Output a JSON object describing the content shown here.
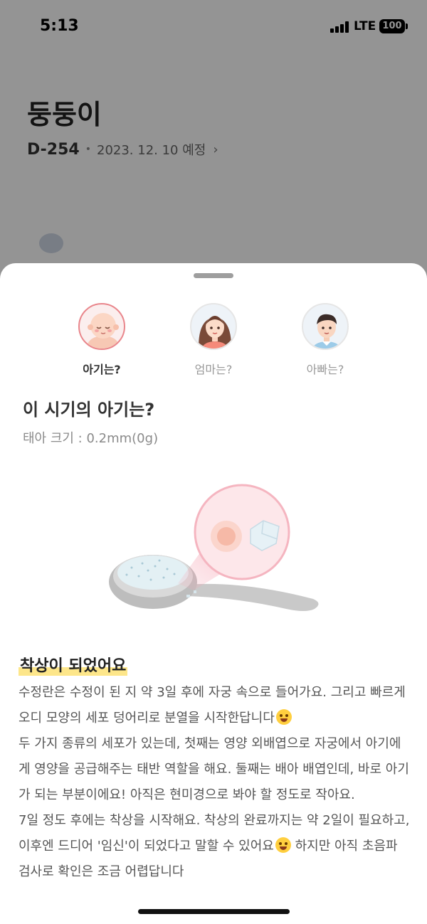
{
  "status_bar": {
    "time": "5:13",
    "network": "LTE",
    "battery": "100"
  },
  "background": {
    "baby_name": "둥둥이",
    "dday": "D-254",
    "separator": "•",
    "due_date": "2023. 12. 10 예정",
    "chevron": "›"
  },
  "sheet": {
    "tabs": [
      {
        "label": "아기는?",
        "icon": "baby-avatar-icon",
        "active": true
      },
      {
        "label": "엄마는?",
        "icon": "mother-avatar-icon",
        "active": false
      },
      {
        "label": "아빠는?",
        "icon": "father-avatar-icon",
        "active": false
      }
    ],
    "title": "이 시기의 아기는?",
    "fetal_size": "태아 크기 : 0.2mm(0g)",
    "illustration": "spoon-with-salt-grains-illustration",
    "headline": "착상이 되었어요",
    "paragraphs": [
      "수정란은 수정이 된 지 약 3일 후에 자궁 속으로 들어가요. 그리고 빠르게 오디 모양의 세포 덩어리로 분열을 시작한답니다",
      "두 가지 종류의 세포가 있는데, 첫째는 영양 외배엽으로 자궁에서 아기에게 영양을 공급해주는 태반 역할을 해요. 둘째는 배아 배엽인데, 바로 아기가 되는 부분이에요! 아직은 현미경으로 봐야 할 정도로 작아요.",
      "7일 정도 후에는 착상을 시작해요. 착상의 완료까지는 약 2일이 필요하고, 이후엔 드디어 '임신'이 되었다고 말할 수 있어요",
      " 하지만 아직 초음파 검사로 확인은 조금 어렵답니다"
    ]
  },
  "colors": {
    "accent_pink": "#e9868c",
    "highlight_yellow": "#fde68a"
  }
}
